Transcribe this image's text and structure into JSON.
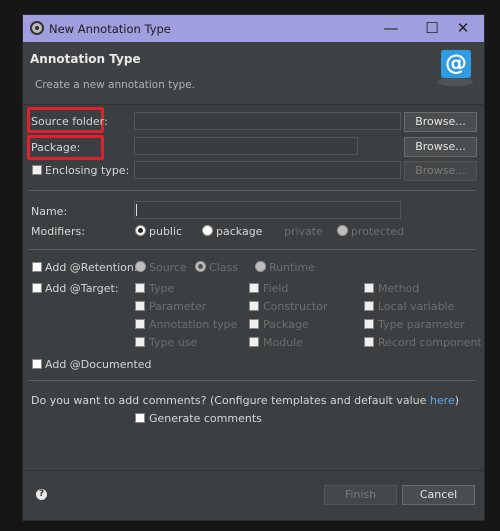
{
  "window": {
    "title": "New Annotation Type",
    "minimize": "—",
    "maximize": "☐",
    "close": "✕"
  },
  "header": {
    "title": "Annotation Type",
    "description": "Create a new annotation type.",
    "logo": "@"
  },
  "form": {
    "source_folder_label": "Source folder:",
    "package_label": "Package:",
    "enclosing_type_label": "Enclosing type:",
    "browse_label": "Browse...",
    "name_label": "Name:",
    "modifiers_label": "Modifiers:",
    "modifiers": [
      "public",
      "package",
      "private",
      "protected"
    ],
    "selected_modifier": "public",
    "add_retention_label": "Add @Retention:",
    "retention_options": [
      "Source",
      "Class",
      "Runtime"
    ],
    "selected_retention": "Class",
    "add_target_label": "Add @Target:",
    "targets": [
      [
        "Type",
        "Field",
        "Method"
      ],
      [
        "Parameter",
        "Constructor",
        "Local variable"
      ],
      [
        "Annotation type",
        "Package",
        "Type parameter"
      ],
      [
        "Type use",
        "Module",
        "Record component"
      ]
    ],
    "add_documented_label": "Add @Documented",
    "comments_question": "Do you want to add comments? (Configure templates and default value ",
    "comments_link": "here",
    "comments_close": ")",
    "generate_comments_label": "Generate comments"
  },
  "footer": {
    "help": "?",
    "finish_label": "Finish",
    "cancel_label": "Cancel"
  }
}
